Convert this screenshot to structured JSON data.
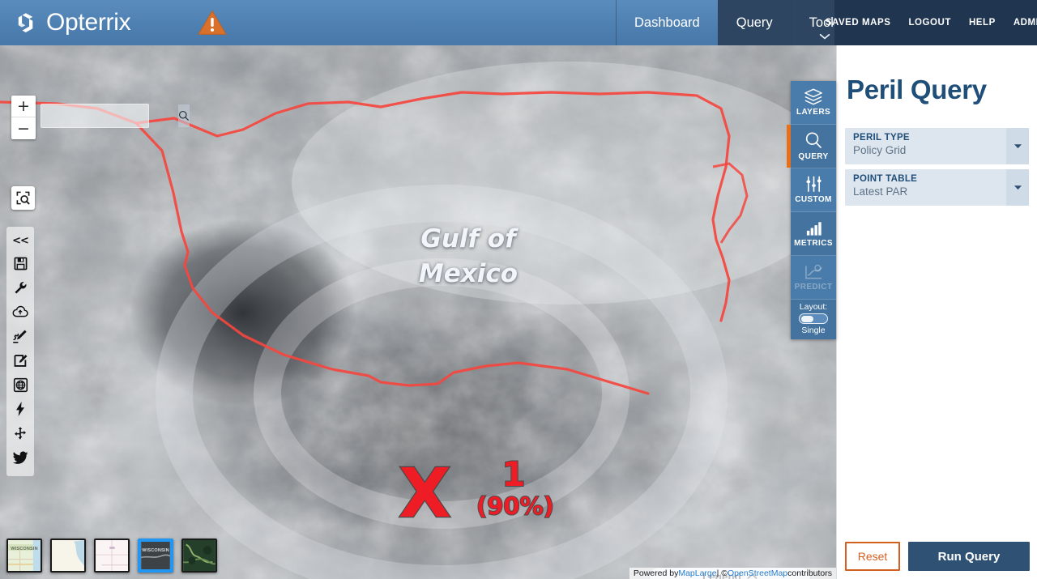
{
  "header": {
    "brand": "Opterrix",
    "logo_icon": "opterrix-logo-icon",
    "warning_icon": "warning-triangle-icon",
    "tabs": [
      {
        "label": "Dashboard",
        "state": "plain"
      },
      {
        "label": "Query",
        "state": "dark"
      },
      {
        "label": "Tools",
        "state": "dark",
        "caret": "chevron-down-icon"
      }
    ],
    "links": [
      "SAVED MAPS",
      "LOGOUT",
      "HELP",
      "ADMIN"
    ],
    "bar_color": "#4f80b2",
    "links_bg": "#1f3550"
  },
  "map": {
    "search_value": "",
    "search_placeholder": "",
    "search_icon": "search-icon",
    "zoom_in": "+",
    "zoom_out": "−",
    "zoom_box_icon": "zoom-to-box-icon",
    "labels": [
      {
        "text": "Gulf of Mexico",
        "kind": "water-label"
      }
    ],
    "markers": [
      {
        "icon": "x-marker-icon",
        "text": "X",
        "color": "#ee1c25"
      },
      {
        "number": "1",
        "percent": "(90%)",
        "color": "#ee1c25"
      }
    ],
    "legend": {
      "label": "Legend",
      "caret": "chevron-up-icon"
    },
    "attribution": {
      "prefix": "Powered by ",
      "provider": "MapLarge",
      "separator": " | © ",
      "osm": "OpenStreetMap",
      "suffix": " contributors"
    },
    "tools": [
      {
        "name": "collapse-toolbar",
        "glyph": "<<"
      },
      {
        "name": "save-icon"
      },
      {
        "name": "wrench-icon"
      },
      {
        "name": "cloud-upload-icon"
      },
      {
        "name": "draw-pen-icon"
      },
      {
        "name": "edit-note-icon"
      },
      {
        "name": "globe-icon"
      },
      {
        "name": "lightning-icon"
      },
      {
        "name": "move-icon"
      },
      {
        "name": "twitter-icon"
      }
    ],
    "basemaps": [
      {
        "name": "streets",
        "label": "WISCONSIN",
        "selected": false
      },
      {
        "name": "light",
        "label": "",
        "selected": false
      },
      {
        "name": "toner",
        "label": "",
        "selected": false
      },
      {
        "name": "satellite",
        "label": "WISCONSIN",
        "selected": true
      },
      {
        "name": "terrain",
        "label": "",
        "selected": false
      }
    ]
  },
  "rail": {
    "tabs": [
      {
        "label": "LAYERS",
        "icon": "layers-icon",
        "active": false,
        "disabled": false
      },
      {
        "label": "QUERY",
        "icon": "search-icon",
        "active": true,
        "disabled": false
      },
      {
        "label": "CUSTOM",
        "icon": "sliders-icon",
        "active": false,
        "disabled": false
      },
      {
        "label": "METRICS",
        "icon": "bar-chart-icon",
        "active": false,
        "disabled": false
      },
      {
        "label": "PREDICT",
        "icon": "predict-chart-icon",
        "active": false,
        "disabled": true
      }
    ],
    "layout": {
      "label": "Layout:",
      "value": "Single",
      "toggle_on": false
    },
    "accent": "#e8701a"
  },
  "panel": {
    "title": "Peril Query",
    "fields": [
      {
        "label": "PERIL TYPE",
        "value": "Policy Grid",
        "caret": "caret-down-icon"
      },
      {
        "label": "POINT TABLE",
        "value": "Latest PAR",
        "caret": "caret-down-icon"
      }
    ],
    "reset_label": "Reset",
    "run_label": "Run Query"
  }
}
